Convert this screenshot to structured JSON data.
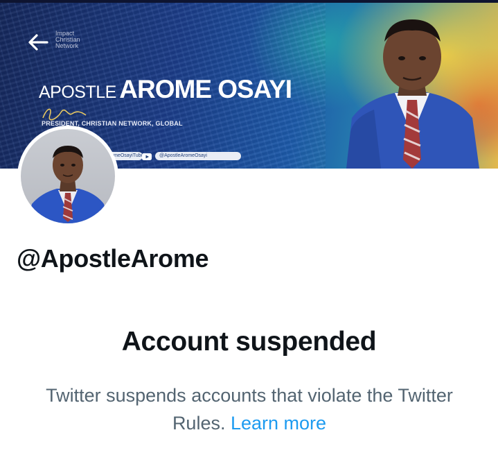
{
  "banner": {
    "logo_text": "Impact\nChristian\nNetwork",
    "title_prefix": "APOSTLE",
    "title_name": "AROME OSAYI",
    "subtitle": "PRESIDENT, CHRISTIAN NETWORK, GLOBAL",
    "social_left": "@ArmeOsayiTube",
    "social_right": "@ApostleAromeOsayi"
  },
  "profile": {
    "handle": "@ApostleArome"
  },
  "suspension": {
    "title": "Account suspended",
    "description": "Twitter suspends accounts that violate the Twitter Rules.",
    "learn_more": "Learn more"
  },
  "icons": {
    "back": "arrow-left-icon",
    "youtube": "youtube-icon"
  },
  "colors": {
    "text_primary": "#0f1419",
    "text_secondary": "#536471",
    "link": "#1d9bf0",
    "background": "#ffffff"
  }
}
